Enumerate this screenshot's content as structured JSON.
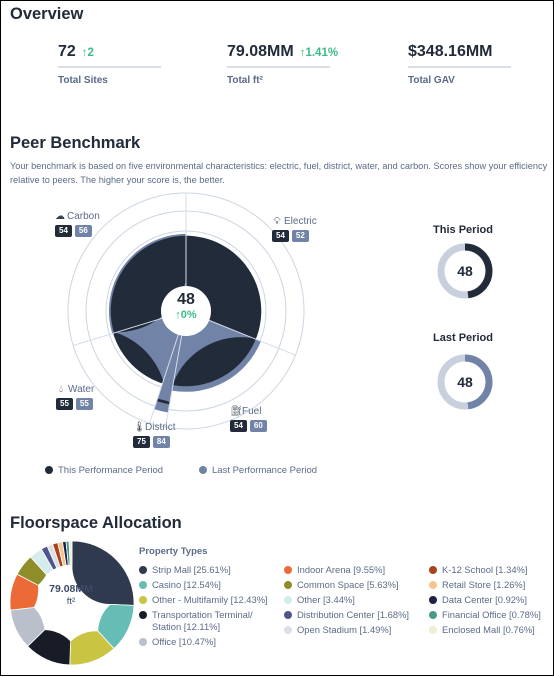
{
  "overview": {
    "title": "Overview",
    "kpis": [
      {
        "value": "72",
        "delta": "↑2",
        "label": "Total Sites"
      },
      {
        "value": "79.08MM",
        "delta": "↑1.41%",
        "label": "Total ft²"
      },
      {
        "value": "$348.16MM",
        "delta": "",
        "label": "Total GAV"
      }
    ]
  },
  "benchmark": {
    "title": "Peer Benchmark",
    "description": "Your benchmark is based on five environmental characteristics: electric, fuel, district, water, and carbon. Scores show your efficiency relative to peers. The higher your score is, the better.",
    "center_score": "48",
    "center_delta": "↑0%",
    "axes": [
      {
        "name": "Electric",
        "icon": "lightbulb-icon",
        "this": 54,
        "last": 52
      },
      {
        "name": "Fuel",
        "icon": "fuel-can-icon",
        "this": 54,
        "last": 60
      },
      {
        "name": "District",
        "icon": "thermometer-icon",
        "this": 75,
        "last": 84
      },
      {
        "name": "Water",
        "icon": "water-drop-icon",
        "this": 55,
        "last": 55
      },
      {
        "name": "Carbon",
        "icon": "cloud-icon",
        "this": 54,
        "last": 56
      }
    ],
    "legend": {
      "this_label": "This Performance Period",
      "last_label": "Last Performance Period"
    },
    "this_period": {
      "title": "This Period",
      "score": "48",
      "value": 48
    },
    "last_period": {
      "title": "Last Period",
      "score": "48",
      "value": 48
    },
    "colors": {
      "this": "#222b3a",
      "last": "#7183a6",
      "track": "#c9d0dd",
      "positive": "#3dbb86"
    }
  },
  "floorspace": {
    "title": "Floorspace Allocation",
    "center_value": "79.08MM",
    "center_unit": "ft²",
    "legend_title": "Property Types"
  },
  "chart_data": {
    "type": "pie",
    "title": "Floorspace Allocation",
    "center_label": "79.08MM ft²",
    "legend_title": "Property Types",
    "slices": [
      {
        "label": "Strip Mall",
        "value": 25.61,
        "color": "#2f3a4e"
      },
      {
        "label": "Casino",
        "value": 12.54,
        "color": "#66bdb6"
      },
      {
        "label": "Other - Multifamily",
        "value": 12.43,
        "color": "#c9c441"
      },
      {
        "label": "Transportation Terminal/ Station",
        "value": 12.11,
        "color": "#171c26"
      },
      {
        "label": "Office",
        "value": 10.47,
        "color": "#b9c0cc"
      },
      {
        "label": "Indoor Arena",
        "value": 9.55,
        "color": "#ec6a35"
      },
      {
        "label": "Common Space",
        "value": 5.63,
        "color": "#8f8d2a"
      },
      {
        "label": "Other",
        "value": 3.44,
        "color": "#d5ecec"
      },
      {
        "label": "Distribution Center",
        "value": 1.68,
        "color": "#4f558c"
      },
      {
        "label": "Open Stadium",
        "value": 1.49,
        "color": "#dddfe8"
      },
      {
        "label": "K-12 School",
        "value": 1.34,
        "color": "#a8431c"
      },
      {
        "label": "Retail Store",
        "value": 1.26,
        "color": "#f6c58e"
      },
      {
        "label": "Data Center",
        "value": 0.92,
        "color": "#1b2147"
      },
      {
        "label": "Financial Office",
        "value": 0.78,
        "color": "#4a9a8a"
      },
      {
        "label": "Enclosed Mall",
        "value": 0.76,
        "color": "#eef0cf"
      }
    ]
  }
}
